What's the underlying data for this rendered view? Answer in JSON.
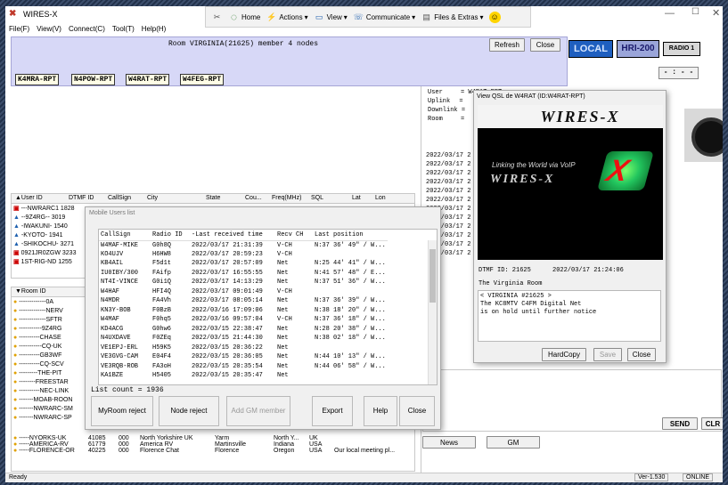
{
  "app": {
    "title": "WIRES-X",
    "menus": [
      "File(F)",
      "View(V)",
      "Connect(C)",
      "Tool(T)",
      "Help(H)"
    ]
  },
  "toolbar": {
    "items": [
      {
        "icon": "tools-icon",
        "label": ""
      },
      {
        "icon": "home-icon",
        "label": "Home"
      },
      {
        "icon": "actions-icon",
        "label": "Actions"
      },
      {
        "icon": "view-icon",
        "label": "View"
      },
      {
        "icon": "communicate-icon",
        "label": "Communicate"
      },
      {
        "icon": "files-icon",
        "label": "Files & Extras"
      },
      {
        "icon": "smiley-icon",
        "label": ""
      }
    ]
  },
  "room": {
    "title": "Room VIRGINIA(21625) member 4 nodes",
    "refresh": "Refresh",
    "close": "Close",
    "members": [
      "K4MRA-RPT",
      "N4POW-RPT",
      "W4RAT-RPT",
      "W4FEG-RPT"
    ]
  },
  "status": {
    "local": "LOCAL",
    "hri": "HRI-200",
    "radio": "RADIO 1",
    "freq": "- : - -"
  },
  "user_info": {
    "labels": [
      "User",
      "Uplink",
      "Downlink",
      "Room"
    ],
    "values": [
      "= W4RAT-RPT",
      "= ",
      "= ",
      "= "
    ]
  },
  "user_list": {
    "headers": [
      "▲User ID",
      "DTMF ID",
      "CallSign",
      "City",
      "State",
      "Cou...",
      "Freq(MHz)",
      "SQL",
      "Lat",
      "Lon"
    ],
    "rows": [
      [
        "---NWRARC1",
        "1828"
      ],
      [
        "--9Z4RG--",
        "3019"
      ],
      [
        "-IWAKUNI-",
        "1540"
      ],
      [
        "-KYOTO-",
        "1941"
      ],
      [
        "-SHIKOCHU-",
        "3271"
      ],
      [
        "0921JR0ZGW",
        "3233"
      ],
      [
        "1ST-RIG-ND",
        "1255"
      ]
    ]
  },
  "room_list": {
    "header": "▼Room ID",
    "rows": [
      "-------------0A",
      "-------------NERV",
      "-------------SFTR",
      "-----------9Z4RG",
      "----------CHASE",
      "-----------CQ-UK",
      "----------GB3WF",
      "----------CQ-SCV",
      "---------THE-PIT",
      "--------FREESTAR",
      "----------NEC-LINK",
      "-------MOAB-ROON",
      "-------NWRARC-SM",
      "-------NWRARC-SP"
    ],
    "details": [
      [
        "-----NYORKS-UK",
        "41085",
        "000",
        "North Yorkshire UK",
        "Yarm",
        "North Y...",
        "UK",
        ""
      ],
      [
        "-----AMERICA-RV",
        "61779",
        "000",
        "America RV",
        "Martinsville",
        "Indiana",
        "USA",
        ""
      ],
      [
        "-----FLORENCE-OR",
        "40225",
        "000",
        "Florence Chat",
        "Florence",
        "Oregon",
        "USA",
        "Our local meeting pl..."
      ]
    ]
  },
  "log": {
    "rows": [
      "2022/03/17 2",
      "2022/03/17 2",
      "2022/03/17 2",
      "2022/03/17 2",
      "2022/03/17 2",
      "2022/03/17 2",
      "2022/03/17 2",
      "2022/03/17 2",
      "2022/03/17 2",
      "2022/03/17 2",
      "2022/03/17 2",
      "2022/03/17 2"
    ]
  },
  "mobile": {
    "title": "Mobile Users list",
    "headers": [
      "CallSign",
      "Radio ID",
      "-Last received time",
      "Recv CH",
      "Last position"
    ],
    "rows": [
      [
        "W4MAF-MIKE",
        "G0h8Q",
        "2022/03/17 21:31:39",
        "V-CH",
        "N:37 36' 49\" / W..."
      ],
      [
        "KO4UJV",
        "H6HW8",
        "2022/03/17 20:59:23",
        "V-CH",
        ""
      ],
      [
        "KB4AIL",
        "F5d1t",
        "2022/03/17 20:57:09",
        "Net",
        "N:25 44' 41\" / W..."
      ],
      [
        "IU0IBY/300",
        "FAifp",
        "2022/03/17 16:55:55",
        "Net",
        "N:41 57' 48\" / E..."
      ],
      [
        "NT4I-VINCE",
        "G0i1Q",
        "2022/03/17 14:13:29",
        "Net",
        "N:37 51' 36\" / W..."
      ],
      [
        "W4HAF",
        "HFI4Q",
        "2022/03/17 09:01:49",
        "V-CH",
        ""
      ],
      [
        "N4MDR",
        "FA4Vh",
        "2022/03/17 08:05:14",
        "Net",
        "N:37 36' 39\" / W..."
      ],
      [
        "KN3Y-BOB",
        "F0BzB",
        "2022/03/16 17:09:06",
        "Net",
        "N:38 18' 20\" / W..."
      ],
      [
        "W4MAF",
        "F0hq5",
        "2022/03/16 09:57:04",
        "V-CH",
        "N:37 36' 18\" / W..."
      ],
      [
        "KD4ACG",
        "G0hw6",
        "2022/03/15 22:38:47",
        "Net",
        "N:28 20' 38\" / W..."
      ],
      [
        "N4UXDAVE",
        "F0ZEq",
        "2022/03/15 21:44:30",
        "Net",
        "N:38 02' 18\" / W..."
      ],
      [
        "VE1EPJ-ERL",
        "H59K5",
        "2022/03/15 20:36:22",
        "Net",
        ""
      ],
      [
        "VE3GVG-CAM",
        "E04F4",
        "2022/03/15 20:36:05",
        "Net",
        "N:44 10' 13\" / W..."
      ],
      [
        "VE3RQB-ROB",
        "FA3oH",
        "2022/03/15 20:35:54",
        "Net",
        "N:44 06' 58\" / W..."
      ],
      [
        "KA1BZE",
        "H5405",
        "2022/03/15 20:35:47",
        "Net",
        ""
      ]
    ],
    "count": "List count = 1936",
    "buttons": {
      "myroom": "MyRoom reject",
      "node": "Node reject",
      "addgm": "Add GM member",
      "export": "Export",
      "help": "Help",
      "close": "Close"
    }
  },
  "qsl": {
    "title": "View QSL de W4RAT (ID:W4RAT-RPT)",
    "brand": "WIRES-X",
    "tagline": "Linking the World via VoIP",
    "dtmf": "DTMF ID: 21625",
    "time": "2022/03/17 21:24:06",
    "room": "The Virginia Room",
    "comment": "< VIRGINIA #21625 >\nThe KC8MTV C4FM Digital Net\nis on hold until further notice",
    "hardcopy": "HardCopy",
    "save": "Save",
    "close": "Close"
  },
  "bottom": {
    "send": "SEND",
    "clr": "CLR",
    "news": "News",
    "gm": "GM",
    "ready": "Ready",
    "version": "Ver-1.530",
    "online": "ONLINE"
  },
  "colors": {
    "room_bg": "#d7d8f7",
    "local_bg": "#1f5fbf",
    "qsl_bg": "#000000",
    "accent_green": "#22c55e"
  }
}
